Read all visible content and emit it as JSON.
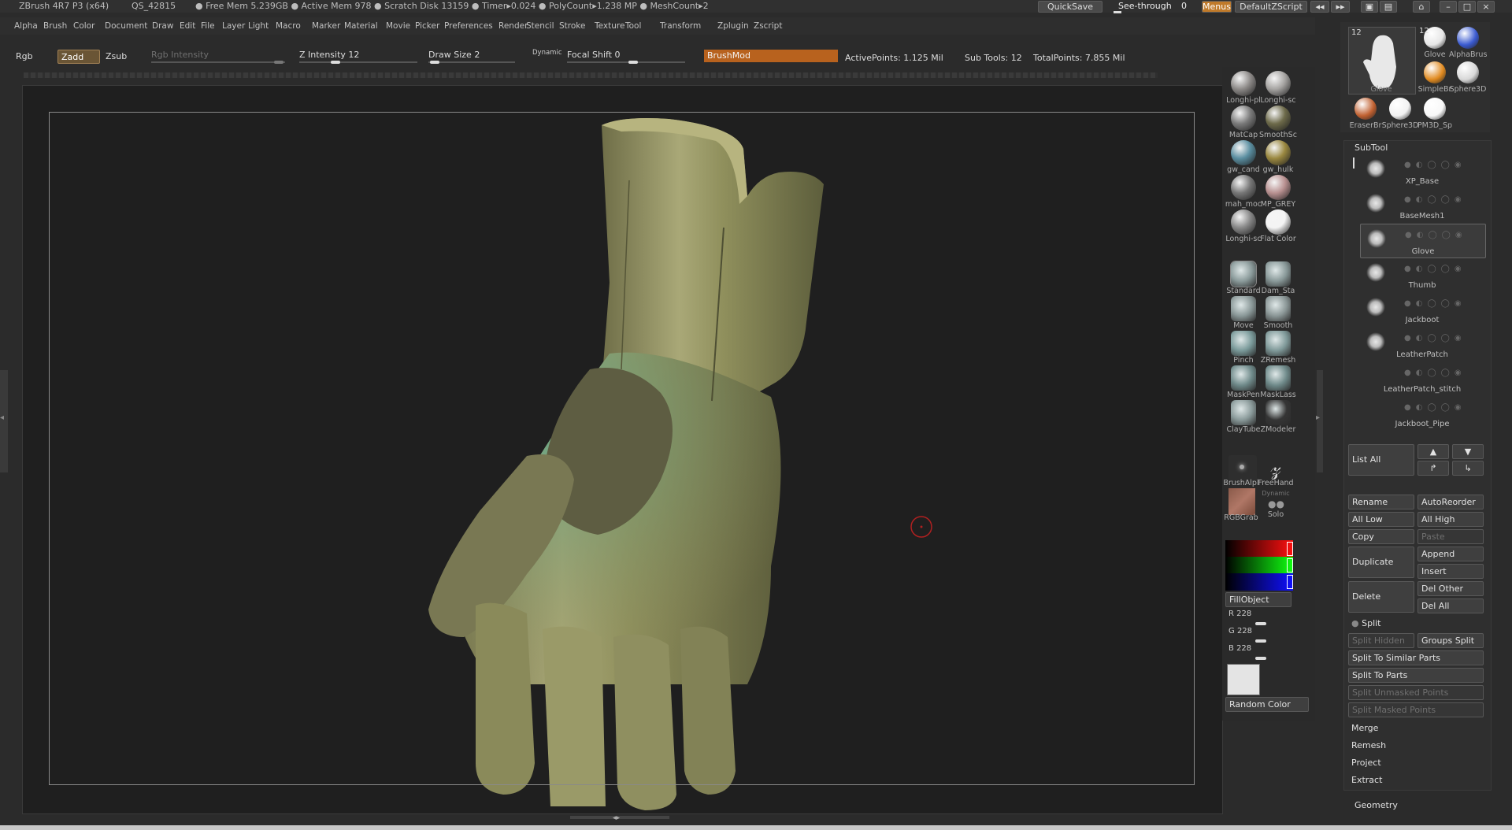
{
  "titlebar": {
    "app": "ZBrush 4R7 P3 (x64)",
    "doc": "QS_42815",
    "stats": "● Free Mem 5.239GB ● Active Mem 978 ● Scratch Disk 13159 ● Timer▸0.024 ● PolyCount▸1.238 MP ● MeshCount▸2",
    "quicksave": "QuickSave",
    "seethrough_label": "See-through",
    "seethrough_value": "0",
    "menus": "Menus",
    "defaultzscript": "DefaultZScript"
  },
  "menubar": [
    "Alpha",
    "Brush",
    "Color",
    "Document",
    "Draw",
    "Edit",
    "File",
    "Layer",
    "Light",
    "Macro",
    "Marker",
    "Material",
    "Movie",
    "Picker",
    "Preferences",
    "Render",
    "Stencil",
    "Stroke",
    "Texture",
    "Tool",
    "Transform",
    "Zplugin",
    "Zscript"
  ],
  "toolbar": {
    "rgb": "Rgb",
    "zadd": "Zadd",
    "zsub": "Zsub",
    "rgb_intensity": "Rgb Intensity",
    "z_intensity_label": "Z Intensity",
    "z_intensity_value": "12",
    "draw_size_label": "Draw Size",
    "draw_size_value": "2",
    "dynamic": "Dynamic",
    "focal_shift_label": "Focal Shift",
    "focal_shift_value": "0",
    "brushmod": "BrushMod",
    "active_points": "ActivePoints: 1.125 Mil",
    "sub_tools": "Sub Tools: 12",
    "total_points": "TotalPoints: 7.855 Mil"
  },
  "materials": [
    {
      "label": "Longhi-pl",
      "color": "#8d8a88"
    },
    {
      "label": "Longhi-sc",
      "color": "#a6a4a2"
    },
    {
      "label": "MatCap",
      "color": "#7b7b7b"
    },
    {
      "label": "SmoothSc",
      "color": "#6d6a4a"
    },
    {
      "label": "gw_cand",
      "color": "#5a8ea0"
    },
    {
      "label": "gw_hulk",
      "color": "#9a8840"
    },
    {
      "label": "mah_moc",
      "color": "#777777"
    },
    {
      "label": "MP_GREY",
      "color": "#b89090"
    },
    {
      "label": "Longhi-sc",
      "color": "#888888"
    },
    {
      "label": "Flat Color",
      "color": "#f4f4f4"
    }
  ],
  "brushes": [
    {
      "label": "Standard",
      "color": "#8a9a9a"
    },
    {
      "label": "Dam_Sta",
      "color": "#889898"
    },
    {
      "label": "Move",
      "color": "#8a9898"
    },
    {
      "label": "Smooth",
      "color": "#8a9696"
    },
    {
      "label": "Pinch",
      "color": "#7a9a9a"
    },
    {
      "label": "ZRemesh",
      "color": "#7f9999"
    },
    {
      "label": "MaskPen",
      "color": "#6f8a8a"
    },
    {
      "label": "MaskLass",
      "color": "#6f8a8a"
    },
    {
      "label": "ClayTube",
      "color": "#8a9a9a"
    },
    {
      "label": "ZModeler",
      "color": "#353535"
    }
  ],
  "stroke": {
    "alpha": "BrushAlpl",
    "freehand": "FreeHand",
    "texture": "RGBGrab",
    "dynamic": "Dynamic",
    "solo": "Solo"
  },
  "color": {
    "fill": "FillObject",
    "r_label": "R",
    "r": "228",
    "g_label": "G",
    "g": "228",
    "b_label": "B",
    "b": "228",
    "random": "Random Color",
    "swatch": "#e4e4e4"
  },
  "tool_thumbs": {
    "main_count": "12",
    "main": "Glove",
    "small_count": "12",
    "items": [
      "Glove",
      "AlphaBrus",
      "SimpleBr",
      "Sphere3D",
      "EraserBr",
      "Sphere3D",
      "PM3D_Sp"
    ]
  },
  "subtool": {
    "title": "SubTool",
    "items": [
      "XP_Base",
      "BaseMesh1",
      "Glove",
      "Thumb",
      "Jackboot",
      "LeatherPatch",
      "LeatherPatch_stitch",
      "Jackboot_Pipe"
    ],
    "selected": "Glove",
    "list_all": "List All"
  },
  "buttons": {
    "rename": "Rename",
    "autoreorder": "AutoReorder",
    "all_low": "All Low",
    "all_high": "All High",
    "copy": "Copy",
    "paste": "Paste",
    "duplicate": "Duplicate",
    "append": "Append",
    "insert": "Insert",
    "delete": "Delete",
    "del_other": "Del Other",
    "del_all": "Del All",
    "split": "Split",
    "split_hidden": "Split Hidden",
    "groups_split": "Groups Split",
    "split_similar": "Split To Similar Parts",
    "split_parts": "Split To Parts",
    "split_unmasked": "Split Unmasked Points",
    "split_masked": "Split Masked Points",
    "merge": "Merge",
    "remesh": "Remesh",
    "project": "Project",
    "extract": "Extract",
    "geometry": "Geometry"
  }
}
